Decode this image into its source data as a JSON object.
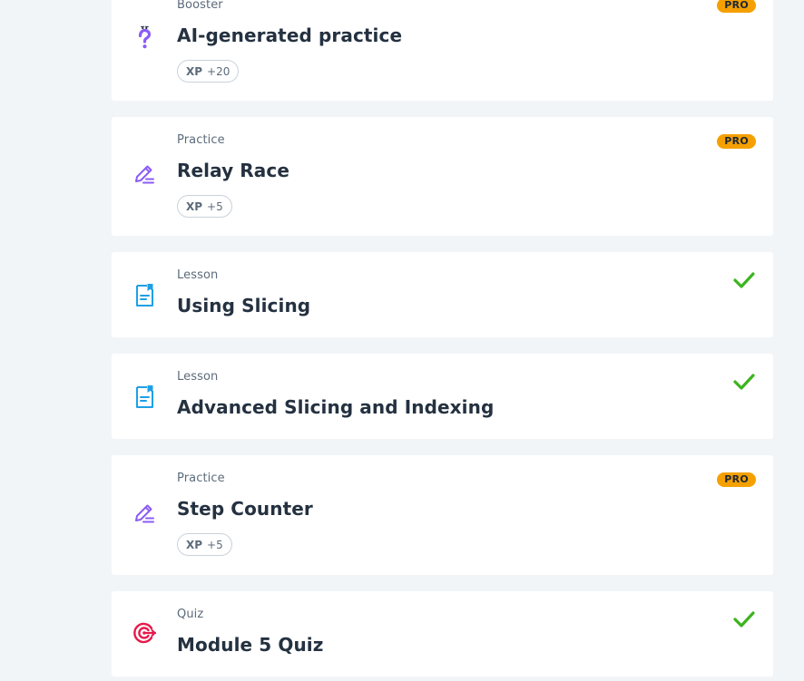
{
  "colors": {
    "background": "#f2f5f8",
    "card": "#ffffff",
    "title": "#243140",
    "meta": "#5c6b7a",
    "pro_badge": "#f5a000",
    "check": "#3cb41e",
    "practice_icon": "#8b5cf6",
    "lesson_icon": "#1ea0e6",
    "quiz_icon": "#e6194b"
  },
  "items": [
    {
      "type": "Booster",
      "title": "AI-generated practice",
      "xp_label": "XP",
      "xp_value": "+20",
      "badge": "PRO",
      "icon": "question-mark-icon",
      "status": "none"
    },
    {
      "type": "Practice",
      "title": "Relay Race",
      "xp_label": "XP",
      "xp_value": "+5",
      "badge": "PRO",
      "icon": "pencil-icon",
      "status": "none"
    },
    {
      "type": "Lesson",
      "title": "Using Slicing",
      "icon": "document-icon",
      "status": "completed"
    },
    {
      "type": "Lesson",
      "title": "Advanced Slicing and Indexing",
      "icon": "document-icon",
      "status": "completed"
    },
    {
      "type": "Practice",
      "title": "Step Counter",
      "xp_label": "XP",
      "xp_value": "+5",
      "badge": "PRO",
      "icon": "pencil-icon",
      "status": "none"
    },
    {
      "type": "Quiz",
      "title": "Module 5 Quiz",
      "icon": "target-icon",
      "status": "completed"
    }
  ]
}
